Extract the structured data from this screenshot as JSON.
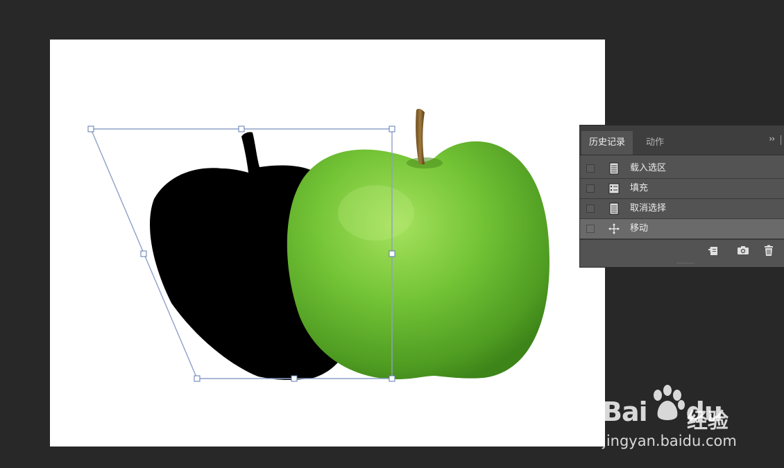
{
  "history_panel": {
    "tabs": [
      {
        "label": "历史记录",
        "active": true
      },
      {
        "label": "动作",
        "active": false
      }
    ],
    "menu_glyph": "››",
    "items": [
      {
        "label": "载入选区",
        "icon": "document-icon",
        "selected": false
      },
      {
        "label": "填充",
        "icon": "list-document-icon",
        "selected": false
      },
      {
        "label": "取消选择",
        "icon": "document-icon",
        "selected": false
      },
      {
        "label": "移动",
        "icon": "move-icon",
        "selected": true
      }
    ],
    "footer_buttons": [
      "new-document-from-state-icon",
      "snapshot-camera-icon",
      "trash-icon"
    ]
  },
  "watermark": {
    "logo_text": "Bai",
    "logo_text2": "du",
    "brand": "经验",
    "url": "jingyan.baidu.com"
  },
  "colors": {
    "workspace_bg": "#282828",
    "panel_bg": "#535353",
    "selected_row": "#6a6a6a",
    "transform_box": "#8ea0c8",
    "apple_green": "#6fc232"
  }
}
